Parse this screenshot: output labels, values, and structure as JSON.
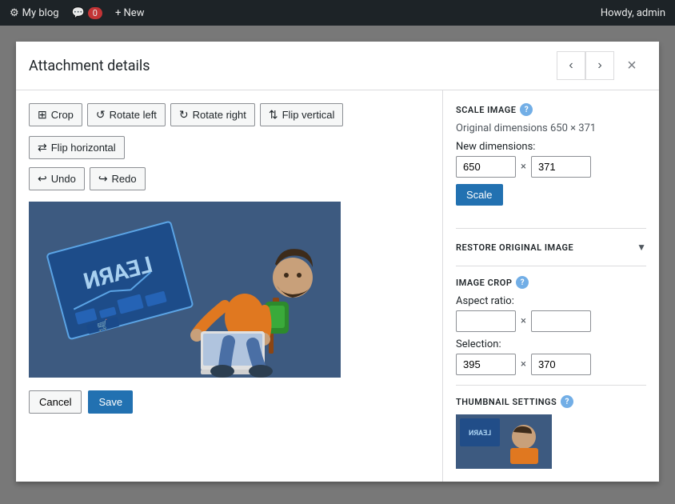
{
  "adminBar": {
    "siteName": "My blog",
    "commentCount": "0",
    "newLabel": "+ New",
    "userLabel": "Howdy, admin"
  },
  "modal": {
    "title": "Attachment details",
    "prevLabel": "‹",
    "nextLabel": "›",
    "closeLabel": "×"
  },
  "toolbar": {
    "cropLabel": "Crop",
    "rotateLeftLabel": "Rotate left",
    "rotateRightLabel": "Rotate right",
    "flipVerticalLabel": "Flip vertical",
    "flipHorizontalLabel": "Flip horizontal"
  },
  "actions": {
    "undoLabel": "Undo",
    "redoLabel": "Redo"
  },
  "bottomButtons": {
    "cancelLabel": "Cancel",
    "saveLabel": "Save"
  },
  "scaleImage": {
    "sectionTitle": "SCALE IMAGE",
    "originalDimensions": "Original dimensions 650 × 371",
    "newDimensionsLabel": "New dimensions:",
    "widthValue": "650",
    "heightValue": "371",
    "timesSep": "×",
    "scaleButtonLabel": "Scale"
  },
  "restoreSection": {
    "title": "RESTORE ORIGINAL IMAGE"
  },
  "imageCrop": {
    "sectionTitle": "IMAGE CROP",
    "aspectRatioLabel": "Aspect ratio:",
    "aspectWidth": "",
    "aspectHeight": "",
    "selectionLabel": "Selection:",
    "selectionWidth": "395",
    "selectionHeight": "370",
    "timesSep": "×"
  },
  "thumbnailSettings": {
    "sectionTitle": "THUMBNAIL SETTINGS"
  },
  "colors": {
    "accent": "#2271b1",
    "adminBarBg": "#1d2327",
    "panelBg": "#f0f0f1",
    "borderColor": "#dcdcde"
  }
}
